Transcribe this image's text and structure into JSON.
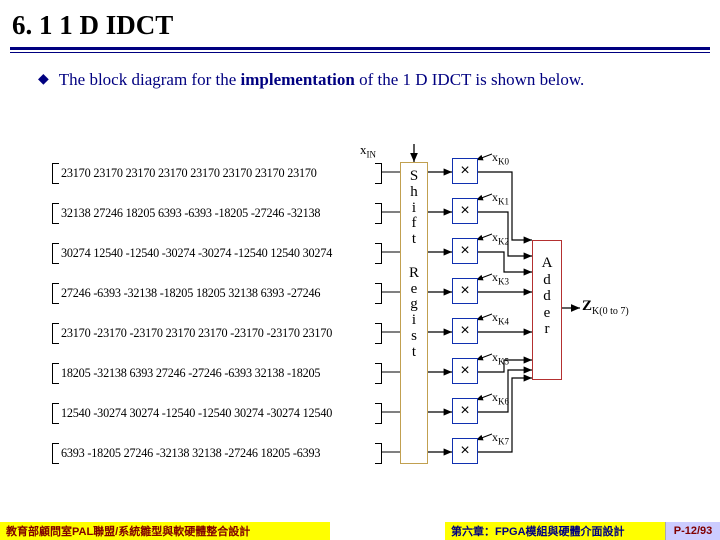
{
  "title": "6. 1 1 D IDCT",
  "bullet_text": "The block diagram for the implementation of the 1 D IDCT is shown below.",
  "xin_label": "x",
  "xin_sub": "IN",
  "shiftreg_top": "S\nh\ni\nf\nt",
  "shiftreg_bot": "R\ne\ng\ni\ns\nt",
  "adder_label": "A\nd\nd\ne\nr",
  "z_label": "Z",
  "z_sub": "K(0 to 7)",
  "k_prefix": "x",
  "k_labels": [
    "K0",
    "K1",
    "K2",
    "K3",
    "K4",
    "K5",
    "K6",
    "K7"
  ],
  "matrix": [
    "23170  23170  23170  23170  23170  23170  23170  23170",
    "32138  27246  18205  6393  -6393 -18205 -27246 -32138",
    "30274  12540 -12540 -30274 -30274 -12540  12540  30274",
    "27246  -6393 -32138 -18205  18205  32138  6393  -27246",
    "23170 -23170 -23170  23170  23170 -23170 -23170  23170",
    "18205 -32138  6393  27246 -27246 -6393  32138 -18205",
    "12540 -30274  30274 -12540 -12540  30274 -30274  12540",
    "6393  -18205  27246 -32138  32138 -27246  18205  -6393"
  ],
  "footer_left": "教育部顧問室PAL聯盟/系統雛型與軟硬體整合設計",
  "footer_right": "第六章：FPGA模組與硬體介面設計",
  "footer_page": "P-12/93",
  "chart_data": {
    "type": "diagram",
    "title": "1D IDCT implementation block diagram",
    "input": "x_IN",
    "coefficient_matrix_rows": 8,
    "coefficient_matrix_cols": 8,
    "coefficient_matrix": [
      [
        23170,
        23170,
        23170,
        23170,
        23170,
        23170,
        23170,
        23170
      ],
      [
        32138,
        27246,
        18205,
        6393,
        -6393,
        -18205,
        -27246,
        -32138
      ],
      [
        30274,
        12540,
        -12540,
        -30274,
        -30274,
        -12540,
        12540,
        30274
      ],
      [
        27246,
        -6393,
        -32138,
        -18205,
        18205,
        32138,
        6393,
        -27246
      ],
      [
        23170,
        -23170,
        -23170,
        23170,
        23170,
        -23170,
        -23170,
        23170
      ],
      [
        18205,
        -32138,
        6393,
        27246,
        -27246,
        -6393,
        32138,
        -18205
      ],
      [
        12540,
        -30274,
        30274,
        -12540,
        -12540,
        30274,
        -30274,
        12540
      ],
      [
        6393,
        -18205,
        27246,
        -32138,
        32138,
        -27246,
        18205,
        -6393
      ]
    ],
    "blocks": [
      "Shift Register",
      "Multipliers (×8)",
      "Adder"
    ],
    "multiplier_inputs": [
      "x_K0",
      "x_K1",
      "x_K2",
      "x_K3",
      "x_K4",
      "x_K5",
      "x_K6",
      "x_K7"
    ],
    "output": "Z_K(0 to 7)"
  }
}
